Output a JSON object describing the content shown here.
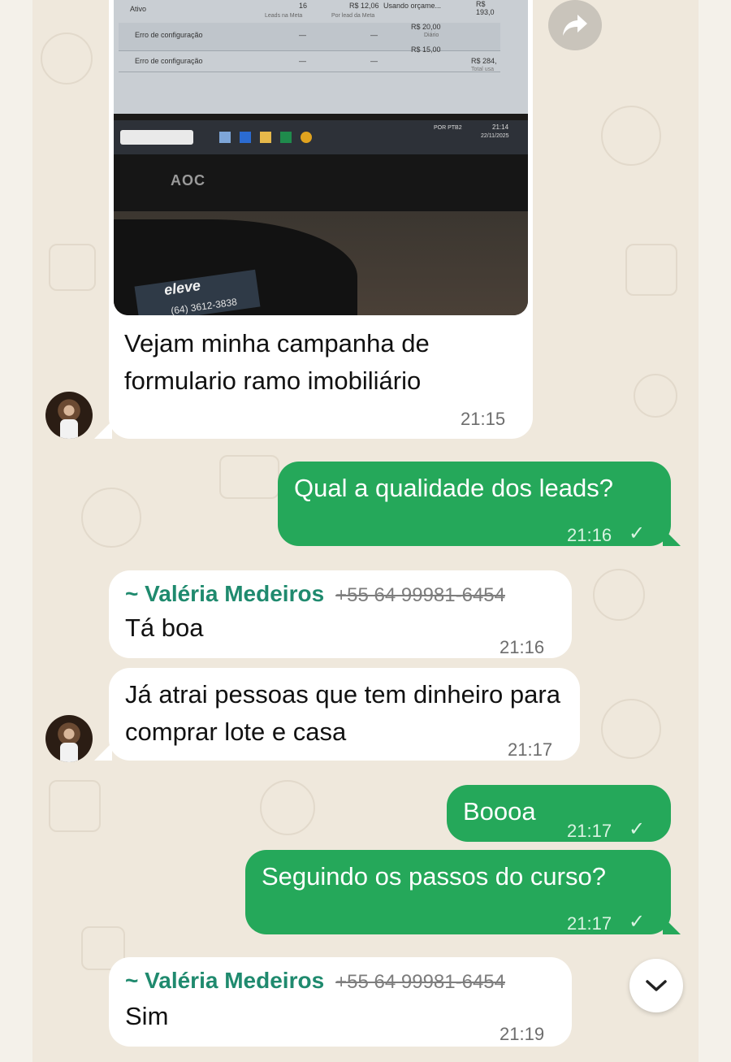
{
  "photo": {
    "screen_rows": [
      {
        "status": "Ativo",
        "leads": "16",
        "leads_caption": "Leads na Meta",
        "cost": "R$ 12,06",
        "cost_caption": "Por lead da Meta",
        "budget": "Usando orçame...",
        "amount": "R$ 193,0"
      },
      {
        "status": "Erro de configuração",
        "leads": "—",
        "leads_caption": "",
        "cost": "—",
        "cost_caption": "",
        "budget": "R$ 20,00",
        "amount": "Diário"
      },
      {
        "status": "Erro de configuração",
        "leads": "—",
        "leads_caption": "",
        "cost": "—",
        "cost_caption": "",
        "budget": "R$ 15,00",
        "amount": ""
      }
    ],
    "total": "R$ 284,",
    "total_caption": "Total usa",
    "tray_lang": "POR PTB2",
    "tray_time": "21:14",
    "tray_date": "22/11/2025",
    "monitor_brand": "AOC",
    "card_brand": "eleve",
    "card_phone": "(64) 3612-3838"
  },
  "messages": [
    {
      "id": "m1",
      "text": "Vejam minha campanha de formulario ramo imobiliário",
      "time": "21:15"
    },
    {
      "id": "m2",
      "text": "Qual a qualidade dos leads?",
      "time": "21:16",
      "status": "✓"
    },
    {
      "id": "m3",
      "sender": "~ Valéria Medeiros",
      "phone": "+55 64 99981-6454",
      "text": "Tá boa",
      "time": "21:16"
    },
    {
      "id": "m4",
      "text": "Já atrai pessoas que tem dinheiro para comprar lote e casa",
      "time": "21:17"
    },
    {
      "id": "m5",
      "text": "Boooa",
      "time": "21:17",
      "status": "✓"
    },
    {
      "id": "m6",
      "text": "Seguindo os passos do curso?",
      "time": "21:17",
      "status": "✓"
    },
    {
      "id": "m7",
      "sender": "~ Valéria Medeiros",
      "phone": "+55 64 99981-6454",
      "text": "Sim",
      "time": "21:19"
    }
  ],
  "colors": {
    "outgoing": "#25a85a",
    "incoming": "#ffffff",
    "sender": "#1f8a6e",
    "wallpaper": "#efe8dc"
  },
  "icons": {
    "forward": "forward-arrow-icon",
    "scroll": "chevron-down-icon",
    "read": "check-icon"
  }
}
